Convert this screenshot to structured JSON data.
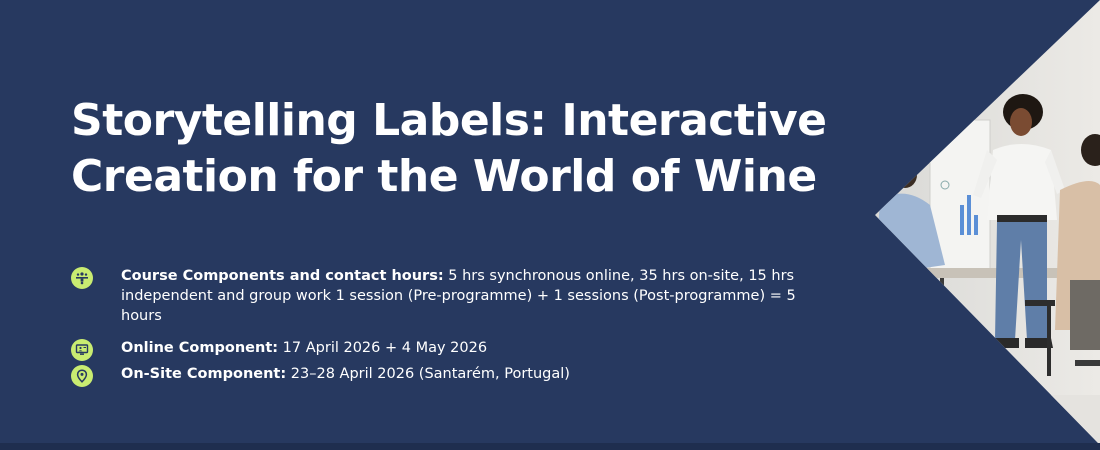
{
  "hero": {
    "title_line1": "Storytelling Labels: Interactive",
    "title_line2": "Creation for the World of Wine"
  },
  "details": [
    {
      "icon": "people-group-icon",
      "label": "Course Components and contact hours:",
      "text": " 5 hrs synchronous online, 35 hrs on-site, 15 hrs independent and group work 1 session (Pre-programme) + 1 sessions (Post-programme) = 5 hours"
    },
    {
      "icon": "online-presentation-icon",
      "label": "Online Component:",
      "text": " 17 April 2026 + 4 May 2026"
    },
    {
      "icon": "location-pin-icon",
      "label": "On-Site Component:",
      "text": " 23–28 April 2026 (Santarém, Portugal)"
    }
  ],
  "colors": {
    "background": "#273960",
    "icon_accent": "#c9ec71",
    "text": "#ffffff"
  }
}
